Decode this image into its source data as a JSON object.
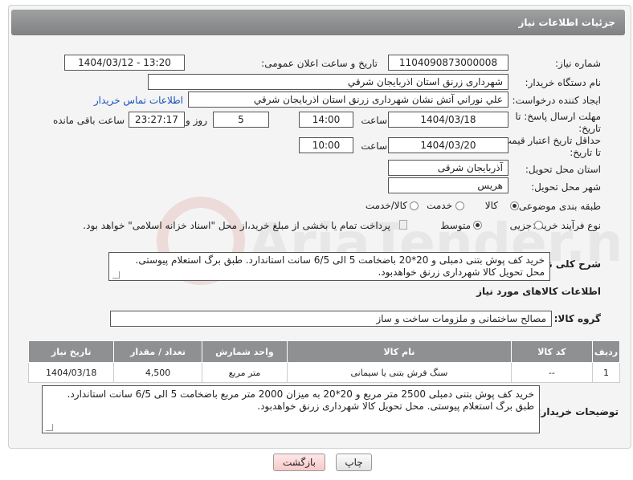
{
  "header": {
    "title": "جزئیات اطلاعات نیاز"
  },
  "fields": {
    "need_number_label": "شماره نیاز:",
    "need_number": "1104090873000008",
    "announce_label": "تاریخ و ساعت اعلان عمومی:",
    "announce_value": "1404/03/12 - 13:20",
    "buyer_org_label": "نام دستگاه خریدار:",
    "buyer_org": "شهرداری زرنق استان اذربایجان شرقي",
    "requester_label": "ایجاد کننده درخواست:",
    "requester": "علي نوراني آتش نشان شهرداری زرنق استان اذربایجان شرقي",
    "contact_link": "اطلاعات تماس خریدار",
    "reply_deadline_label_1": "مهلت ارسال پاسخ: تا",
    "reply_deadline_label_2": "تاریخ:",
    "reply_date": "1404/03/18",
    "time_label": "ساعت",
    "reply_time": "14:00",
    "days_value": "5",
    "days_label": "روز و",
    "remaining_time": "23:27:17",
    "remaining_label": "ساعت باقی مانده",
    "price_validity_label_1": "حداقل تاریخ اعتبار قیمت:",
    "price_validity_label_2": "تا تاریخ:",
    "price_date": "1404/03/20",
    "price_time": "10:00",
    "province_label": "استان محل تحویل:",
    "province": "آذربایجان شرقی",
    "city_label": "شهر محل تحویل:",
    "city": "هریس",
    "category_label": "طبقه بندی موضوعی:",
    "category_options": [
      "کالا",
      "خدمت",
      "کالا/خدمت"
    ],
    "purchase_type_label": "نوع فرآیند خرید :",
    "purchase_options": [
      "جزیی",
      "متوسط"
    ],
    "payment_note": "پرداخت تمام یا بخشی از مبلغ خرید،از محل \"اسناد خزانه اسلامی\" خواهد بود.",
    "description_label": "شرح کلی نیاز:",
    "description": "خرید کف پوش بتنی دمبلی و 20*20  باضخامت 5 الی 6/5 سانت استاندارد. طبق برگ استعلام پیوستی. محل تحویل کالا شهرداری زرنق خواهدبود.",
    "goods_info_title": "اطلاعات کالاهای مورد نیاز",
    "goods_group_label": "گروه کالا:",
    "goods_group": "مصالح ساختمانی و ملزومات ساخت و ساز",
    "buyer_notes_label": "توضیحات خریدار:",
    "buyer_notes": "خرید کف پوش بتنی دمبلی  2500 متر مربع و 20*20 به  میزان 2000 متر مربع باضخامت 5 الی 6/5 سانت استاندارد. طبق برگ استعلام پیوستی. محل تحویل کالا شهرداری زرنق خواهدبود."
  },
  "table": {
    "headers": [
      "ردیف",
      "کد کالا",
      "نام کالا",
      "واحد شمارش",
      "تعداد / مقدار",
      "تاریخ نیاز"
    ],
    "rows": [
      [
        "1",
        "--",
        "سنگ فرش بتنی یا سیمانی",
        "متر مربع",
        "4,500",
        "1404/03/18"
      ]
    ]
  },
  "buttons": {
    "print": "چاپ",
    "back": "بازگشت"
  },
  "watermark": "AriaTender.neT",
  "colors": {
    "header_bg": "#8e9092",
    "link": "#1a4fb8",
    "back_button": "#f8c9c9"
  }
}
